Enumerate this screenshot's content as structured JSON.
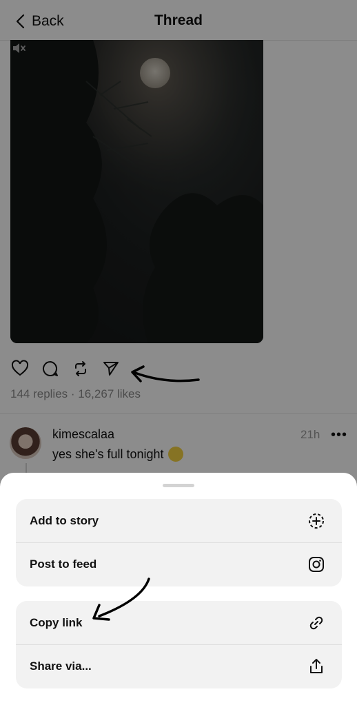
{
  "header": {
    "back_label": "Back",
    "title": "Thread"
  },
  "post": {
    "stats": "144 replies · 16,267 likes",
    "actions": [
      {
        "name": "like",
        "icon": "heart-icon"
      },
      {
        "name": "comment",
        "icon": "comment-icon"
      },
      {
        "name": "repost",
        "icon": "repost-icon"
      },
      {
        "name": "share",
        "icon": "send-icon"
      }
    ]
  },
  "comment": {
    "username": "kimescalaa",
    "text": "yes she's full tonight",
    "time": "21h",
    "more": "•••"
  },
  "sheet": {
    "group1": [
      {
        "label": "Add to story",
        "icon": "add-story-icon"
      },
      {
        "label": "Post to feed",
        "icon": "instagram-icon"
      }
    ],
    "group2": [
      {
        "label": "Copy link",
        "icon": "link-icon"
      },
      {
        "label": "Share via...",
        "icon": "share-upload-icon"
      }
    ]
  }
}
